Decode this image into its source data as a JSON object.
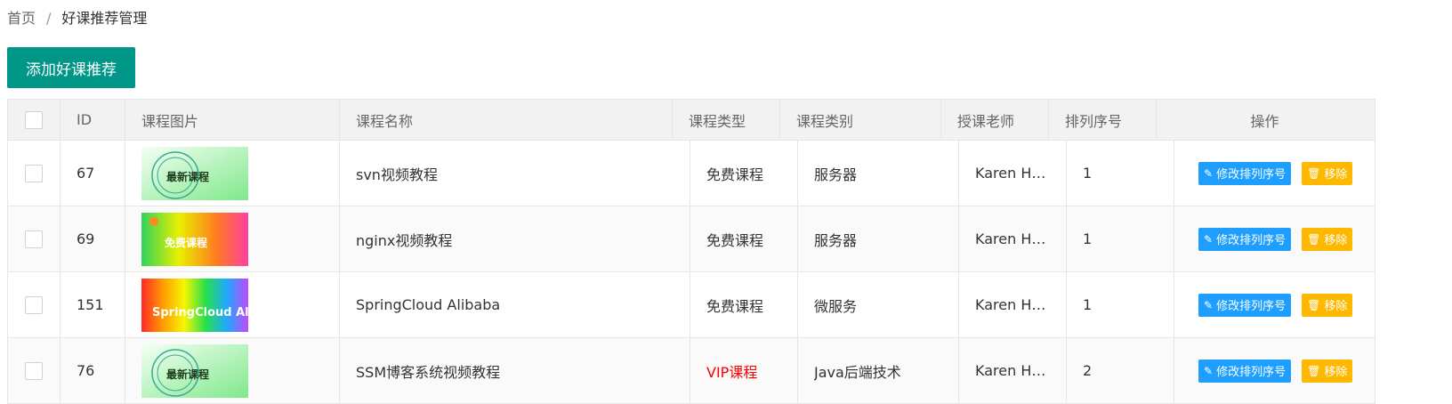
{
  "breadcrumb": {
    "home": "首页",
    "separator": "/",
    "current": "好课推荐管理"
  },
  "toolbar": {
    "add_label": "添加好课推荐"
  },
  "table": {
    "headers": {
      "id": "ID",
      "image": "课程图片",
      "name": "课程名称",
      "type": "课程类型",
      "category": "课程类别",
      "teacher": "授课老师",
      "sort": "排列序号",
      "action": "操作"
    },
    "rows": [
      {
        "id": "67",
        "name": "svn视频教程",
        "type": "免费课程",
        "category": "服务器",
        "teacher": "Karen H…",
        "sort": "1",
        "thumb_text": "最新课程",
        "thumb_style": "green"
      },
      {
        "id": "69",
        "name": "nginx视频教程",
        "type": "免费课程",
        "category": "服务器",
        "teacher": "Karen H…",
        "sort": "1",
        "thumb_text": "免费课程",
        "thumb_style": "rainbow"
      },
      {
        "id": "151",
        "name": "SpringCloud Alibaba",
        "type": "免费课程",
        "category": "微服务",
        "teacher": "Karen H…",
        "sort": "1",
        "thumb_text": "SpringCloud Ali",
        "thumb_style": "spectrum"
      },
      {
        "id": "76",
        "name": "SSM博客系统视频教程",
        "type": "VIP课程",
        "category": "Java后端技术",
        "teacher": "Karen H…",
        "sort": "2",
        "thumb_text": "最新课程",
        "thumb_style": "green"
      }
    ],
    "actions": {
      "edit_label": "修改排列序号",
      "delete_label": "移除"
    }
  },
  "colors": {
    "primary": "#009688",
    "edit": "#1e9fff",
    "delete": "#ffb800",
    "vip": "#ff0000"
  }
}
